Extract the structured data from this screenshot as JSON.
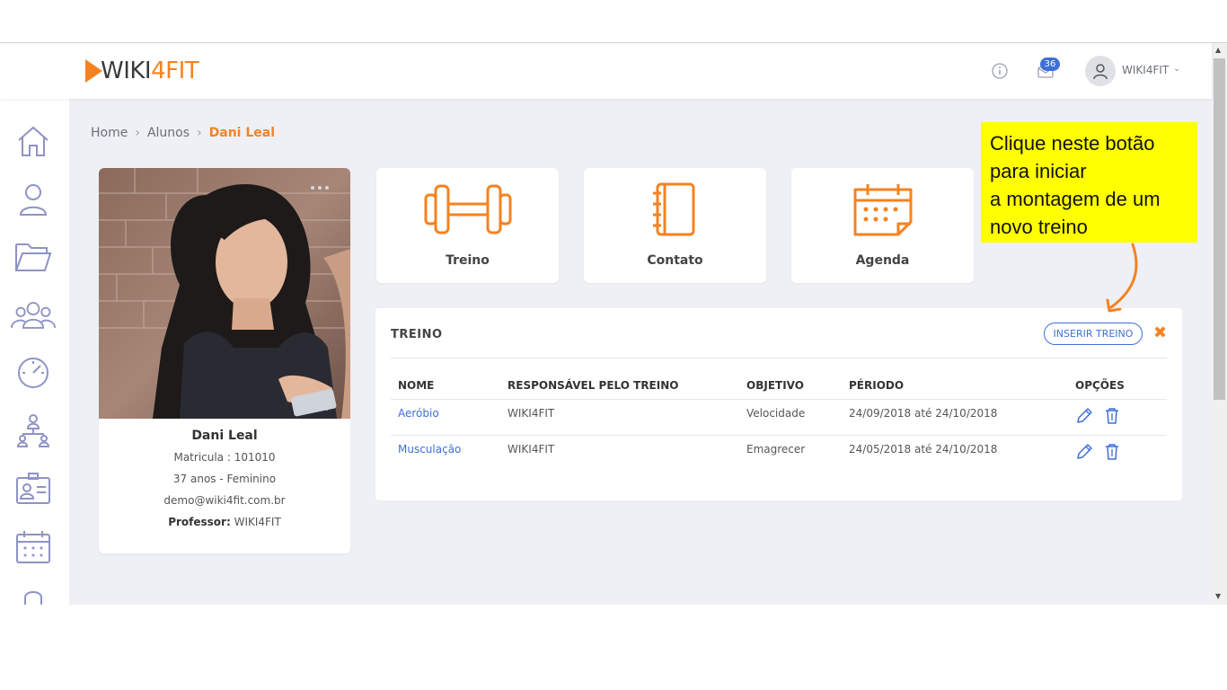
{
  "header": {
    "logo_part1": "WIKI",
    "logo_part2": "4FIT",
    "notification_count": "36",
    "user_name": "WIKI4FIT"
  },
  "sidebar": {
    "items": [
      {
        "icon": "home-icon"
      },
      {
        "icon": "user-icon"
      },
      {
        "icon": "folder-icon"
      },
      {
        "icon": "group-icon"
      },
      {
        "icon": "gauge-icon"
      },
      {
        "icon": "hierarchy-icon"
      },
      {
        "icon": "id-card-icon"
      },
      {
        "icon": "calendar-icon"
      }
    ]
  },
  "breadcrumb": {
    "home": "Home",
    "alunos": "Alunos",
    "current": "Dani Leal"
  },
  "profile": {
    "name": "Dani Leal",
    "matricula": "Matricula : 101010",
    "age_gender": "37 anos - Feminino",
    "email": "demo@wiki4fit.com.br",
    "professor_label": "Professor:",
    "professor_value": "WIKI4FIT"
  },
  "tiles": {
    "treino": "Treino",
    "contato": "Contato",
    "agenda": "Agenda"
  },
  "panel": {
    "title": "TREINO",
    "insert_button": "INSERIR TREINO",
    "close": "✖",
    "headers": [
      "NOME",
      "RESPONSÁVEL PELO TREINO",
      "OBJETIVO",
      "PÉRIODO",
      "OPÇÕES"
    ],
    "rows": [
      {
        "nome": "Aeróbio",
        "responsavel": "WIKI4FIT",
        "objetivo": "Velocidade",
        "periodo": "24/09/2018 até 24/10/2018"
      },
      {
        "nome": "Musculação",
        "responsavel": "WIKI4FIT",
        "objetivo": "Emagrecer",
        "periodo": "24/05/2018 até 24/10/2018"
      }
    ]
  },
  "callout": {
    "line1": "Clique neste botão",
    "line2": "para iniciar",
    "line3": "a montagem de um",
    "line4": "novo treino"
  },
  "colors": {
    "accent": "#f58220",
    "primary": "#3d6fd9",
    "background": "#eef0f5",
    "callout": "#ffff00"
  }
}
